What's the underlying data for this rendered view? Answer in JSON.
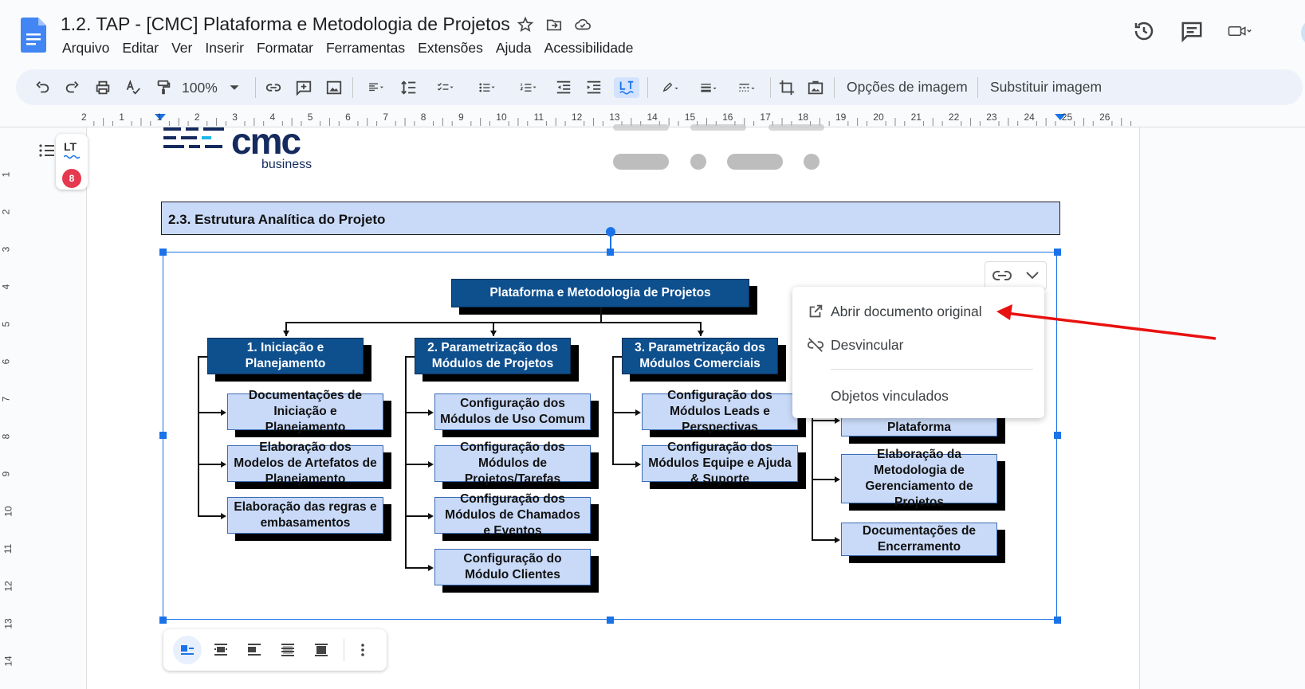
{
  "doc": {
    "title": "1.2. TAP - [CMC] Plataforma e Metodologia de Projetos"
  },
  "menu": [
    "Arquivo",
    "Editar",
    "Ver",
    "Inserir",
    "Formatar",
    "Ferramentas",
    "Extensões",
    "Ajuda",
    "Acessibilidade"
  ],
  "toolbar": {
    "zoom": "100%",
    "image_options": "Opções de imagem",
    "replace_image": "Substituir imagem"
  },
  "ruler": {
    "h_marks": [
      "2",
      "1",
      "1",
      "2",
      "3",
      "4",
      "5",
      "6",
      "7",
      "8",
      "9",
      "10",
      "11",
      "12",
      "13",
      "14",
      "15",
      "16",
      "17",
      "18",
      "19",
      "20",
      "21",
      "22",
      "23",
      "24",
      "25",
      "26"
    ],
    "v_marks": [
      "1",
      "2",
      "3",
      "4",
      "5",
      "6",
      "7",
      "8",
      "9",
      "10",
      "11",
      "12",
      "13",
      "14"
    ]
  },
  "lt": {
    "logo": "LT",
    "count": "8"
  },
  "logo": {
    "brand": "cmc",
    "sub": "business"
  },
  "section": {
    "heading": "2.3. Estrutura Analítica do Projeto"
  },
  "wbs": {
    "root": "Plataforma e Metodologia de Projetos",
    "phases": [
      {
        "title": "1. Iniciação e Planejamento",
        "items": [
          "Documentações de Iniciação e Planejamento",
          "Elaboração dos Modelos de Artefatos de Planejamento",
          "Elaboração das regras e embasamentos"
        ]
      },
      {
        "title": "2. Parametrização dos Módulos de Projetos",
        "items": [
          "Configuração dos Módulos de Uso Comum",
          "Configuração dos Módulos de Projetos/Tarefas",
          "Configuração dos Módulos de Chamados e Eventos",
          "Configuração do Módulo Clientes"
        ]
      },
      {
        "title": "3. Parametrização dos Módulos Comerciais",
        "items": [
          "Configuração dos Módulos Leads e Perspectivas",
          "Configuração dos Módulos Equipe e Ajuda & Suporte"
        ]
      },
      {
        "title": "",
        "items": [
          "Trabalho de uso da Plataforma",
          "Elaboração da Metodologia de Gerenciamento de Projetos",
          "Documentações de Encerramento"
        ]
      }
    ]
  },
  "popup": {
    "open_original": "Abrir documento original",
    "unlink": "Desvincular",
    "linked_objects": "Objetos vinculados"
  },
  "colors": {
    "accent": "#1a73e8",
    "dark_box": "#0e4f8e",
    "light_box": "#c9daf8",
    "arrow": "#e8110f"
  }
}
